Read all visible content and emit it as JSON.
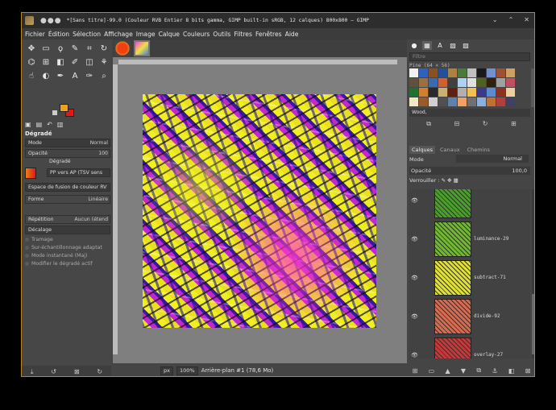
{
  "window": {
    "title": "*[Sans titre]-99.0 (Couleur RVB Entier 8 bits gamma, GIMP built-in sRGB, 12 calques) 800x800 – GIMP",
    "controls": [
      "⌄",
      "⌃",
      "✕"
    ]
  },
  "menu": [
    "Fichier",
    "Édition",
    "Sélection",
    "Affichage",
    "Image",
    "Calque",
    "Couleurs",
    "Outils",
    "Filtres",
    "Fenêtres",
    "Aide"
  ],
  "tools": [
    {
      "icon": "move-icon",
      "glyph": "✥"
    },
    {
      "icon": "rect-select-icon",
      "glyph": "▭"
    },
    {
      "icon": "lasso-icon",
      "glyph": "ϙ"
    },
    {
      "icon": "fuzzy-select-icon",
      "glyph": "✎"
    },
    {
      "icon": "crop-icon",
      "glyph": "⌗"
    },
    {
      "icon": "rotate-icon",
      "glyph": "↻"
    },
    {
      "icon": "warp-icon",
      "glyph": "⌬"
    },
    {
      "icon": "transform-icon",
      "glyph": "⊞"
    },
    {
      "icon": "bucket-fill-icon",
      "glyph": "◧"
    },
    {
      "icon": "paintbrush-icon",
      "glyph": "✐"
    },
    {
      "icon": "eraser-icon",
      "glyph": "◫"
    },
    {
      "icon": "clone-icon",
      "glyph": "⚘"
    },
    {
      "icon": "smudge-icon",
      "glyph": "☝"
    },
    {
      "icon": "dodge-icon",
      "glyph": "◐"
    },
    {
      "icon": "path-icon",
      "glyph": "✒"
    },
    {
      "icon": "text-icon",
      "glyph": "A"
    },
    {
      "icon": "color-picker-icon",
      "glyph": "✑"
    },
    {
      "icon": "zoom-icon",
      "glyph": "⌕"
    }
  ],
  "colors": {
    "foreground": "#f0a020",
    "background": "#e01818"
  },
  "tool_options": {
    "title": "Dégradé",
    "mode_label": "Mode",
    "mode_value": "Normal",
    "opacity_label": "Opacité",
    "opacity_value": "100",
    "gradient_label": "Dégradé",
    "gradient_value": "PP vers AP (TSV sens",
    "blend_space": "Espace de fusion de couleur RV",
    "shape_label": "Forme",
    "shape_value": "Linéaire",
    "repeat_label": "Répétition",
    "repeat_value": "Aucun (étend",
    "offset_label": "Décalage",
    "dithering": "Tramage",
    "adaptive": "Sur-échantillonnage adaptat",
    "instant": "Mode instantané (Maj)",
    "modify": "Modifier le dégradé actif"
  },
  "statusbar": {
    "unit": "px",
    "zoom": "100%",
    "info": "Arrière-plan #1 (78,6 Mo)"
  },
  "patterns_panel": {
    "filter_placeholder": "Filtre",
    "label": "Pine (64 × 56)",
    "selected": "Wood,",
    "swatches": [
      "#f0f0f0",
      "#3060c0",
      "#8a5020",
      "#2050a0",
      "#b08040",
      "#4a7a3a",
      "#c0c0c0",
      "#1a1a1a",
      "#7090d0",
      "#a05030",
      "#d0a060",
      "#605040",
      "#9a7040",
      "#3a6ab0",
      "#d06030",
      "#404040",
      "#b0d0f0",
      "#e0e0e0",
      "#506020",
      "#302010",
      "#a0a0a0",
      "#c05060",
      "#207030",
      "#d08030",
      "#2a2a2a",
      "#c8b070",
      "#602010",
      "#b0b0b0",
      "#f0c050",
      "#3a3a8a",
      "#5a8ad0",
      "#903020",
      "#e8d0a0",
      "#f0e8c0",
      "#9a5a2a",
      "#d0d0d0",
      "#505050",
      "#6080b0",
      "#f0a060",
      "#707070",
      "#8ab0e0",
      "#c07030",
      "#b04040",
      "#404060"
    ]
  },
  "layers_panel": {
    "tabs": [
      "Calques",
      "Canaux",
      "Chemins"
    ],
    "mode_label": "Mode",
    "mode_value": "Normal",
    "opacity_label": "Opacité",
    "opacity_value": "100,0",
    "lock_label": "Verrouiller :",
    "layers": [
      {
        "name": "",
        "color": "#48a028",
        "visible": true
      },
      {
        "name": "luminance-29",
        "color": "#70b830",
        "visible": true
      },
      {
        "name": "subtract-71",
        "color": "#e0e030",
        "visible": true
      },
      {
        "name": "divide-92",
        "color": "#d86a50",
        "visible": true
      },
      {
        "name": "overlay-27",
        "color": "#c83838",
        "visible": true
      },
      {
        "name": "",
        "color": "#f07818",
        "visible": false
      }
    ]
  }
}
